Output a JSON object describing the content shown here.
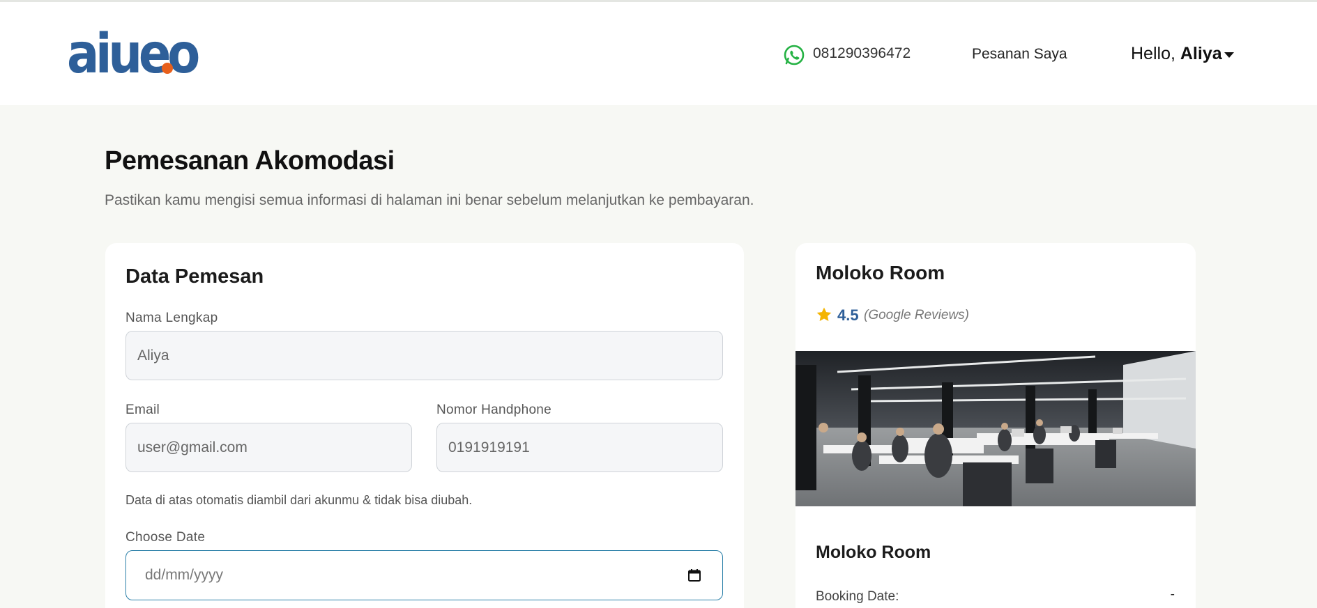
{
  "header": {
    "logo_text": "aiueo",
    "phone": "081290396472",
    "orders_label": "Pesanan Saya",
    "greeting": "Hello,",
    "user_name": "Aliya",
    "accent_color": "#2e5f99",
    "logo_dot_color": "#e8601c"
  },
  "page": {
    "title": "Pemesanan Akomodasi",
    "subtitle": "Pastikan kamu mengisi semua informasi di halaman ini benar sebelum melanjutkan ke pembayaran."
  },
  "form": {
    "title": "Data Pemesan",
    "name_label": "Nama Lengkap",
    "name_value": "Aliya",
    "email_label": "Email",
    "email_value": "user@gmail.com",
    "phone_label": "Nomor Handphone",
    "phone_value": "0191919191",
    "note": "Data di atas otomatis diambil dari akunmu & tidak bisa diubah.",
    "date_label": "Choose Date",
    "date_placeholder": "dd/mm/yyyy"
  },
  "summary": {
    "room_name": "Moloko Room",
    "rating": "4.5",
    "reviews_label": "(Google Reviews)",
    "room_name_2": "Moloko Room",
    "booking_date_label": "Booking Date:",
    "booking_date_value": "-",
    "star_color": "#f4b400"
  }
}
